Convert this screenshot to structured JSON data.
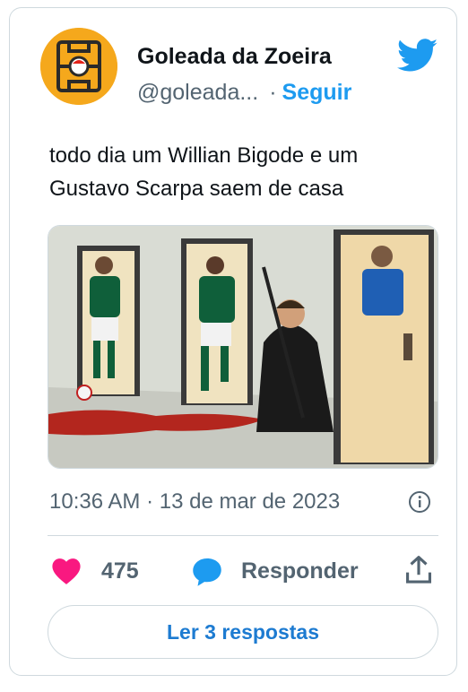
{
  "account": {
    "display_name": "Goleada da Zoeira",
    "handle": "@goleada...",
    "separator": "·",
    "follow_label": "Seguir"
  },
  "tweet": {
    "text": "todo dia um Willian Bigode e um Gustavo Scarpa saem de casa",
    "timestamp": "10:36 AM · 13 de mar de 2023"
  },
  "actions": {
    "like_count": "475",
    "reply_label": "Responder"
  },
  "read_replies_label": "Ler 3 respostas",
  "colors": {
    "accent": "#1d9bf0",
    "heart": "#f91880",
    "muted": "#536471",
    "avatar_bg": "#f5a81c"
  },
  "icons": [
    "twitter-bird-icon",
    "info-icon",
    "heart-icon",
    "reply-bubble-icon",
    "share-icon"
  ]
}
